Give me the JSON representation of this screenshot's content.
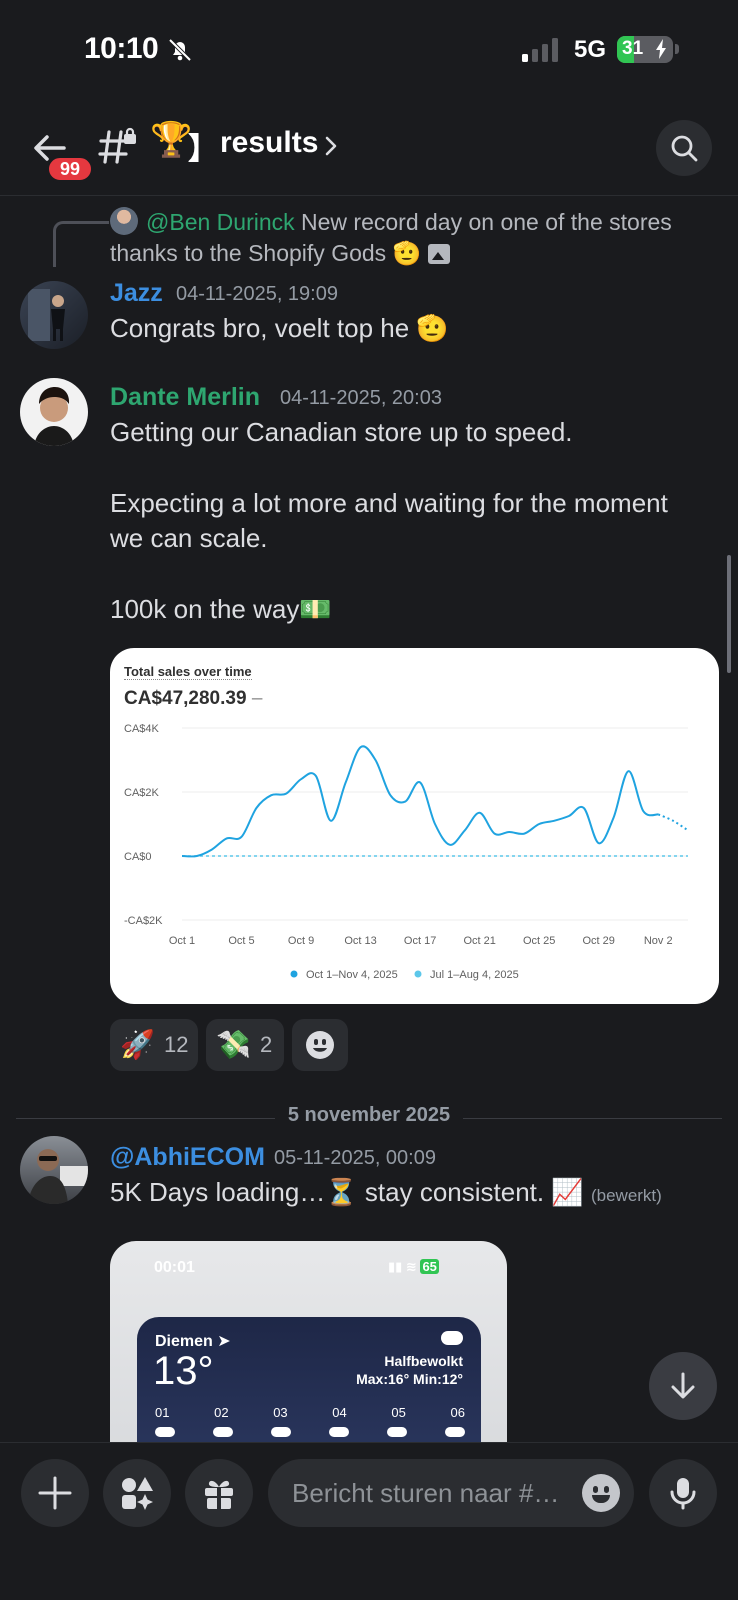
{
  "status_bar": {
    "time": "10:10",
    "network": "5G",
    "battery": "31",
    "battery_fraction": 0.31
  },
  "header": {
    "unread_badge": "99",
    "channel_emoji": "🏆",
    "channel_bracket": "】",
    "channel_name": "results"
  },
  "messages": [
    {
      "reply_to": {
        "author": "@Ben Durinck",
        "text": "New record day on one of the stores thanks to the Shopify Gods 🫡"
      },
      "author": "Jazz",
      "timestamp": "04-11-2025, 19:09",
      "text": "Congrats bro, voelt top he 🫡"
    },
    {
      "author": "Dante Merlin",
      "timestamp": "04-11-2025, 20:03",
      "lines": [
        "Getting our Canadian store up to speed.",
        "Expecting a lot more and waiting for the moment",
        "we can scale.",
        "100k on the way💵"
      ],
      "reactions": [
        {
          "emoji": "🚀",
          "count": "12"
        },
        {
          "emoji": "💸",
          "count": "2"
        }
      ]
    },
    {
      "author": "@AbhiECOM",
      "timestamp": "05-11-2025, 00:09",
      "text": "5K Days loading…⏳ stay consistent. 📈",
      "edited": "(bewerkt)"
    }
  ],
  "embed_chart": {
    "title": "Total sales over time",
    "total": "CA$47,280.39",
    "total_suffix": "–"
  },
  "chart_data": {
    "type": "line",
    "y_ticks": [
      "CA$4K",
      "CA$2K",
      "CA$0",
      "-CA$2K"
    ],
    "ylim": [
      -2000,
      4000
    ],
    "x_ticks": [
      "Oct 1",
      "Oct 5",
      "Oct 9",
      "Oct 13",
      "Oct 17",
      "Oct 21",
      "Oct 25",
      "Oct 29",
      "Nov 2"
    ],
    "series": [
      {
        "name": "Oct 1–Nov 4, 2025",
        "color": "#1fa3e0",
        "x": [
          "Oct 1",
          "Oct 2",
          "Oct 3",
          "Oct 4",
          "Oct 5",
          "Oct 6",
          "Oct 7",
          "Oct 8",
          "Oct 9",
          "Oct 10",
          "Oct 11",
          "Oct 12",
          "Oct 13",
          "Oct 14",
          "Oct 15",
          "Oct 16",
          "Oct 17",
          "Oct 18",
          "Oct 19",
          "Oct 20",
          "Oct 21",
          "Oct 22",
          "Oct 23",
          "Oct 24",
          "Oct 25",
          "Oct 26",
          "Oct 27",
          "Oct 28",
          "Oct 29",
          "Oct 30",
          "Oct 31",
          "Nov 1",
          "Nov 2",
          "Nov 3",
          "Nov 4"
        ],
        "values": [
          0,
          0,
          200,
          550,
          600,
          1500,
          1900,
          1950,
          2400,
          2500,
          1100,
          2300,
          3400,
          3000,
          1900,
          1700,
          2300,
          1000,
          350,
          800,
          1350,
          700,
          750,
          700,
          1000,
          1100,
          1250,
          1500,
          400,
          1200,
          2650,
          1400,
          1300,
          1100,
          800
        ]
      },
      {
        "name": "Jul 1–Aug 4, 2025",
        "color": "#5cc7ea",
        "x": [
          "Oct 1",
          "Nov 4"
        ],
        "values": [
          0,
          0
        ]
      }
    ],
    "grid": true,
    "legend": "bottom"
  },
  "date_divider": "5 november 2025",
  "embed_screenshot": {
    "clock": "00:01",
    "battery": "65",
    "city": "Diemen",
    "temperature": "13°",
    "condition": "Halfbewolkt",
    "range": "Max:16° Min:12°",
    "hours": [
      "01",
      "02",
      "03",
      "04",
      "05",
      "06"
    ]
  },
  "composer": {
    "placeholder": "Bericht sturen naar #…"
  }
}
